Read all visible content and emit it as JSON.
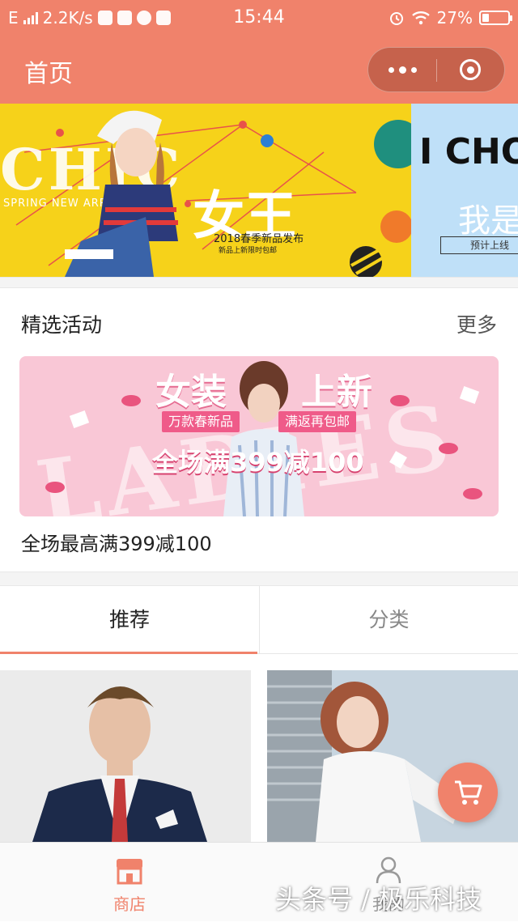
{
  "status_bar": {
    "network": "E",
    "speed": "2.2K/s",
    "time": "15:44",
    "battery": "27%",
    "battery_level": 0.27
  },
  "nav": {
    "title": "首页"
  },
  "banner": {
    "slide1": {
      "big_text": "CHIC",
      "sub_text": "SPRING NEW ARRIVAL",
      "title": "女王",
      "caption": "2018春季新品发布",
      "caption_small": "新品上新限时包邮"
    },
    "slide2": {
      "title": "I CHO",
      "subtitle": "我是",
      "box_text": "预计上线"
    }
  },
  "featured": {
    "title": "精选活动",
    "more": "更多"
  },
  "promo": {
    "ladies": "LADIES",
    "title_left": "女装",
    "title_right": "上新",
    "pill_left": "万款春新品",
    "pill_right": "满返再包邮",
    "deal": "全场满399减100",
    "caption": "全场最高满399减100"
  },
  "tabs": [
    {
      "label": "推荐"
    },
    {
      "label": "分类"
    }
  ],
  "tabbar": [
    {
      "label": "商店"
    },
    {
      "label": "我的"
    }
  ],
  "watermark": "头条号 / 极乐科技",
  "colors": {
    "accent": "#f0826b",
    "banner_yellow": "#f6d21a",
    "promo_pink": "#f9c7d6"
  },
  "icons": [
    "shop-icon",
    "person-icon",
    "cart-icon",
    "more-dots-icon",
    "close-ring-icon"
  ]
}
